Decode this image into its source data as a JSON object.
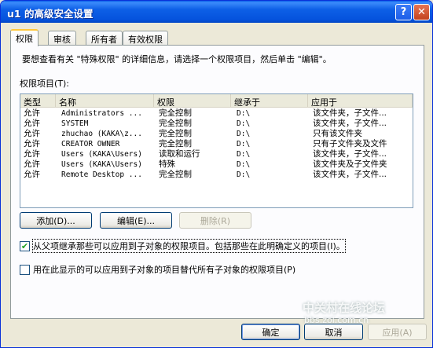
{
  "window": {
    "title": "u1 的高级安全设置"
  },
  "tabs": [
    "权限",
    "审核",
    "所有者",
    "有效权限"
  ],
  "description": "要想查看有关 \"特殊权限\" 的详细信息，请选择一个权限项目，然后单击 \"编辑\"。",
  "list_label": "权限项目(T):",
  "columns": [
    "类型",
    "名称",
    "权限",
    "继承于",
    "应用于"
  ],
  "rows": [
    {
      "type": "允许",
      "name": "Administrators ...",
      "perm": "完全控制",
      "inherit": "D:\\",
      "apply": "该文件夹，子文件..."
    },
    {
      "type": "允许",
      "name": "SYSTEM",
      "perm": "完全控制",
      "inherit": "D:\\",
      "apply": "该文件夹，子文件..."
    },
    {
      "type": "允许",
      "name": "zhuchao (KAKA\\z...",
      "perm": "完全控制",
      "inherit": "D:\\",
      "apply": "只有该文件夹"
    },
    {
      "type": "允许",
      "name": "CREATOR OWNER",
      "perm": "完全控制",
      "inherit": "D:\\",
      "apply": "只有子文件夹及文件"
    },
    {
      "type": "允许",
      "name": "Users (KAKA\\Users)",
      "perm": "读取和运行",
      "inherit": "D:\\",
      "apply": "该文件夹，子文件..."
    },
    {
      "type": "允许",
      "name": "Users (KAKA\\Users)",
      "perm": "特殊",
      "inherit": "D:\\",
      "apply": "该文件夹及子文件夹"
    },
    {
      "type": "允许",
      "name": "Remote Desktop ...",
      "perm": "完全控制",
      "inherit": "D:\\",
      "apply": "该文件夹，子文件..."
    }
  ],
  "buttons": {
    "add": "添加(D)...",
    "edit": "编辑(E)...",
    "remove": "删除(R)"
  },
  "checks": {
    "inherit": "从父项继承那些可以应用到子对象的权限项目。包括那些在此明确定义的项目(I)。",
    "inherit_checked": true,
    "replace": "用在此显示的可以应用到子对象的项目替代所有子对象的权限项目(P)",
    "replace_checked": false
  },
  "footer": {
    "ok": "确定",
    "cancel": "取消",
    "apply": "应用(A)"
  },
  "watermark": {
    "name": "中关村在线论坛",
    "url": "bbs.zol.com.cn"
  }
}
